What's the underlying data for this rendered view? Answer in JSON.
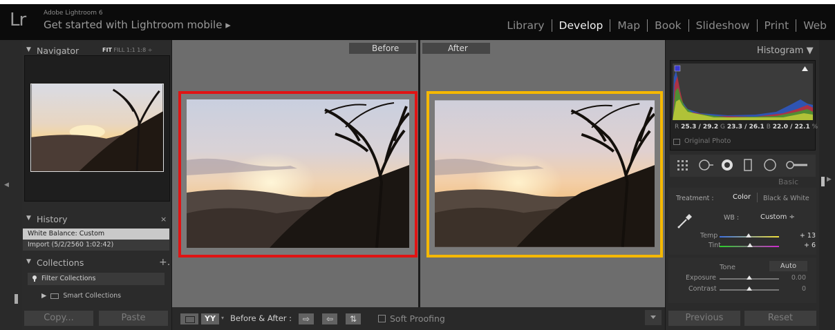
{
  "app": {
    "logo": "Lr",
    "version": "Adobe Lightroom 6",
    "mobile_link": "Get started with Lightroom mobile ▸"
  },
  "modules": [
    {
      "label": "Library",
      "active": false
    },
    {
      "label": "Develop",
      "active": true
    },
    {
      "label": "Map",
      "active": false
    },
    {
      "label": "Book",
      "active": false
    },
    {
      "label": "Slideshow",
      "active": false
    },
    {
      "label": "Print",
      "active": false
    },
    {
      "label": "Web",
      "active": false
    }
  ],
  "navigator": {
    "title": "Navigator",
    "zoom_fit": "FIT",
    "zoom_options": "FILL  1:1  1:8 ÷"
  },
  "history": {
    "title": "History",
    "close": "×",
    "items": [
      {
        "label": "White Balance: Custom",
        "selected": true
      },
      {
        "label": "Import (5/2/2560 1:02:42)",
        "selected": false
      }
    ]
  },
  "collections": {
    "title": "Collections",
    "add": "+.",
    "filter_placeholder": "Filter Collections",
    "smart": "Smart Collections"
  },
  "left_buttons": {
    "copy": "Copy...",
    "paste": "Paste"
  },
  "compare": {
    "before": "Before",
    "after": "After",
    "before_border": "#e01414",
    "after_border": "#f5b800"
  },
  "toolbar": {
    "yy": "YY",
    "ba_label": "Before & After :",
    "soft_proofing": "Soft Proofing"
  },
  "histogram": {
    "title": "Histogram ▼",
    "r_label": "R",
    "r_value": "25.3 / 29.2",
    "g_label": "G",
    "g_value": "23.3 / 26.1",
    "b_label": "B",
    "b_value": "22.0 / 22.1",
    "pct": "%",
    "original_photo": "Original Photo"
  },
  "basic": {
    "title": "Basic",
    "treatment_label": "Treatment :",
    "treatment_color": "Color",
    "treatment_bw": "Black & White",
    "wb_label": "WB :",
    "wb_value": "Custom ÷",
    "temp_label": "Temp",
    "temp_value": "+ 13",
    "tint_label": "Tint",
    "tint_value": "+ 6",
    "tone_label": "Tone",
    "auto": "Auto",
    "exposure_label": "Exposure",
    "exposure_value": "0.00",
    "contrast_label": "Contrast",
    "contrast_value": "0"
  },
  "right_buttons": {
    "previous": "Previous",
    "reset": "Reset"
  }
}
